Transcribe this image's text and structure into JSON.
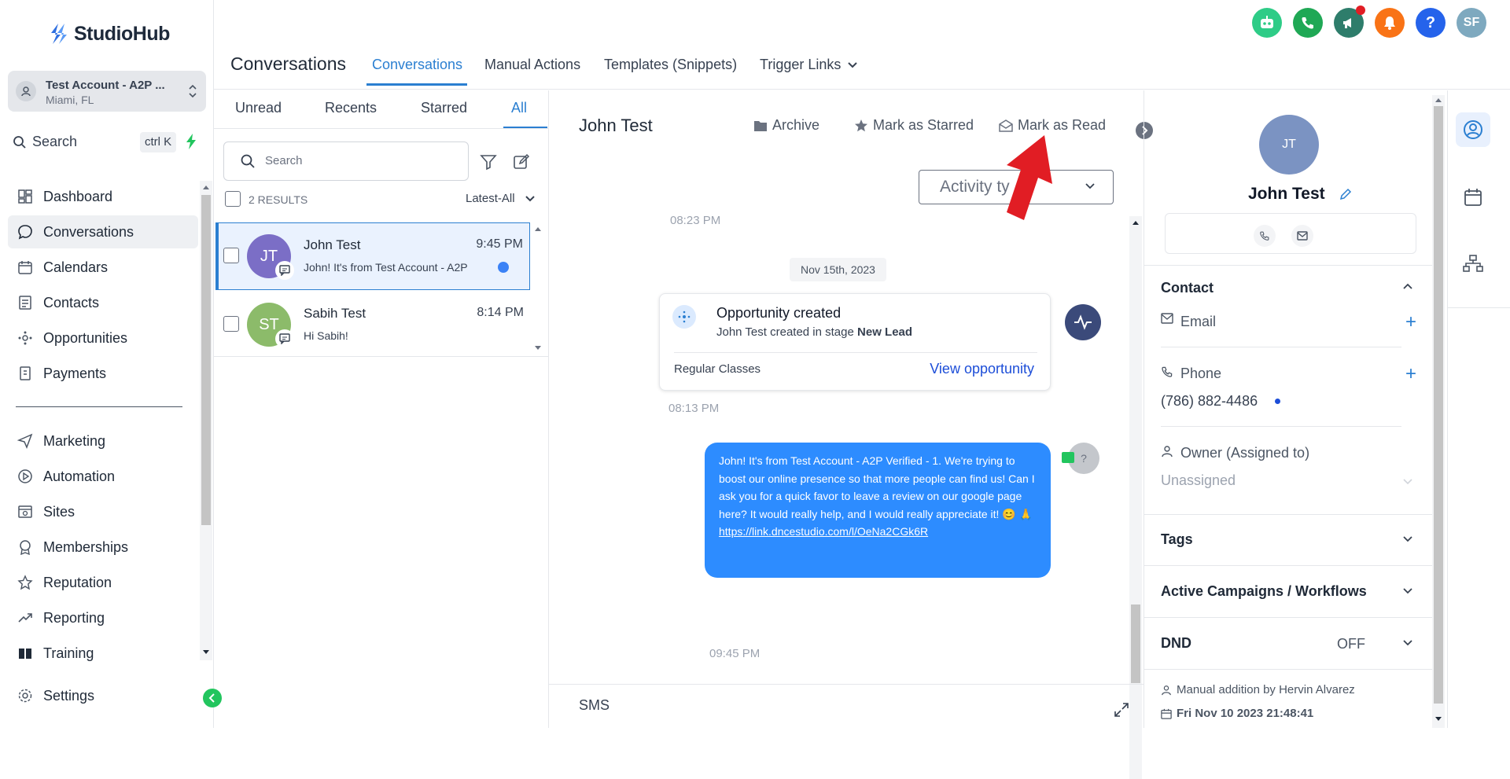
{
  "app": {
    "logo_text": "StudioHub"
  },
  "account": {
    "name": "Test Account - A2P ...",
    "location": "Miami, FL"
  },
  "sidebar": {
    "search_label": "Search",
    "search_shortcut": "ctrl K",
    "items": [
      {
        "label": "Dashboard",
        "icon": "dashboard-icon"
      },
      {
        "label": "Conversations",
        "icon": "chat-icon",
        "active": true
      },
      {
        "label": "Calendars",
        "icon": "calendar-icon"
      },
      {
        "label": "Contacts",
        "icon": "contacts-icon"
      },
      {
        "label": "Opportunities",
        "icon": "opportunities-icon"
      },
      {
        "label": "Payments",
        "icon": "payments-icon"
      },
      {
        "label": "Marketing",
        "icon": "send-icon"
      },
      {
        "label": "Automation",
        "icon": "automation-icon"
      },
      {
        "label": "Sites",
        "icon": "sites-icon"
      },
      {
        "label": "Memberships",
        "icon": "badge-icon"
      },
      {
        "label": "Reputation",
        "icon": "star-icon"
      },
      {
        "label": "Reporting",
        "icon": "trend-icon"
      },
      {
        "label": "Training",
        "icon": "book-icon"
      }
    ],
    "settings_label": "Settings"
  },
  "header": {
    "title": "Conversations",
    "tabs": [
      {
        "label": "Conversations",
        "active": true
      },
      {
        "label": "Manual Actions"
      },
      {
        "label": "Templates (Snippets)"
      },
      {
        "label": "Trigger Links"
      }
    ],
    "user_initials": "SF",
    "help_label": "?"
  },
  "conv_list": {
    "filters": [
      "Unread",
      "Recents",
      "Starred",
      "All"
    ],
    "active_filter": "All",
    "search_placeholder": "Search",
    "results": "2 RESULTS",
    "sort": "Latest-All",
    "rows": [
      {
        "initials": "JT",
        "name": "John Test",
        "preview": "John! It's from Test Account - A2P",
        "time": "9:45 PM",
        "avatar_color": "#7b6ec6",
        "unread": true,
        "selected": true
      },
      {
        "initials": "ST",
        "name": "Sabih Test",
        "preview": "Hi Sabih!",
        "time": "8:14 PM",
        "avatar_color": "#8cbb6a",
        "unread": false,
        "selected": false
      }
    ]
  },
  "chat": {
    "name": "John Test",
    "actions": {
      "archive": "Archive",
      "star": "Mark as Starred",
      "read": "Mark as Read"
    },
    "activity_filter": "Activity ty",
    "time_top": "08:23 PM",
    "date_pill": "Nov 15th, 2023",
    "opportunity": {
      "title": "Opportunity created",
      "sub_prefix": "John Test created in stage ",
      "stage": "New Lead",
      "pipeline": "Regular Classes",
      "link": "View opportunity"
    },
    "time_opp": "08:13 PM",
    "message": {
      "text": "John! It's  from Test Account - A2P Verified - 1. We're trying to boost our online presence so that more people can find us! Can I ask you for a quick favor to leave a review on our google page here? It would really help, and I would really appreciate it! 😊 🙏",
      "link": "https://link.dncestudio.com/l/OeNa2CGk6R",
      "avatar": "?"
    },
    "time_msg": "09:45 PM",
    "composer_channel": "SMS"
  },
  "contact": {
    "initials": "JT",
    "name": "John Test",
    "section_contact": "Contact",
    "email_label": "Email",
    "phone_label": "Phone",
    "phone_value": "(786) 882-4486",
    "owner_label": "Owner (Assigned to)",
    "owner_value": "Unassigned",
    "tags": "Tags",
    "campaigns": "Active Campaigns / Workflows",
    "dnd": "DND",
    "dnd_value": "OFF",
    "footer_source": "Manual addition by Hervin Alvarez",
    "footer_date": "Fri Nov 10 2023 21:48:41"
  },
  "colors": {
    "accent": "#2b7fd1",
    "message_bubble": "#2d8cff",
    "arrow": "#e11d24",
    "green": "#22c55e"
  }
}
